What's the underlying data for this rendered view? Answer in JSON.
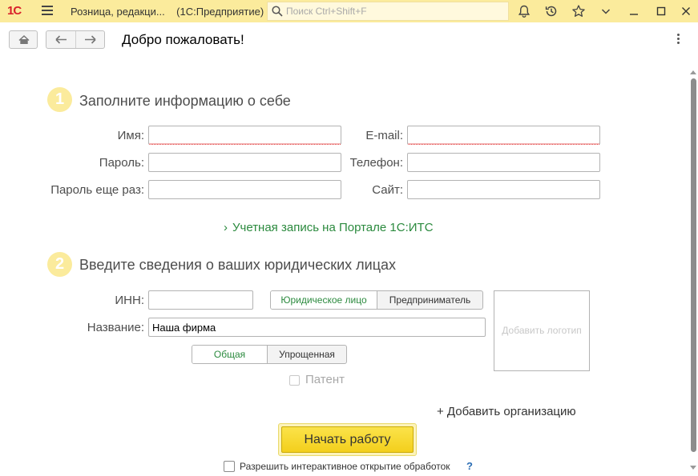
{
  "titlebar": {
    "logo": "1С",
    "app_title": "Розница, редакци...",
    "platform": "(1С:Предприятие)",
    "search_placeholder": "Поиск Ctrl+Shift+F",
    "icons": [
      "bell-icon",
      "history-icon",
      "star-icon",
      "chevron-down-icon",
      "minimize-icon",
      "maximize-icon",
      "close-icon"
    ]
  },
  "toolbar": {
    "page_title": "Добро пожаловать!",
    "icons": [
      "home-icon",
      "arrow-left-icon",
      "arrow-right-icon",
      "more-vertical-icon"
    ]
  },
  "section1": {
    "number": "1",
    "title": "Заполните информацию о себе",
    "fields": {
      "name": {
        "label": "Имя:",
        "value": ""
      },
      "password": {
        "label": "Пароль:",
        "value": ""
      },
      "password_repeat": {
        "label": "Пароль еще раз:",
        "value": ""
      },
      "email": {
        "label": "E-mail:",
        "value": ""
      },
      "phone": {
        "label": "Телефон:",
        "value": ""
      },
      "site": {
        "label": "Сайт:",
        "value": ""
      }
    },
    "its_link": "Учетная запись на Портале 1С:ИТС"
  },
  "section2": {
    "number": "2",
    "title": "Введите сведения о ваших юридических лицах",
    "inn": {
      "label": "ИНН:",
      "value": ""
    },
    "org_name": {
      "label": "Название:",
      "value": "Наша фирма"
    },
    "entity_type": {
      "options": [
        "Юридическое лицо",
        "Предприниматель"
      ],
      "selected": "Юридическое лицо"
    },
    "tax_system": {
      "options": [
        "Общая",
        "Упрощенная"
      ],
      "selected": "Общая"
    },
    "patent_label": "Патент",
    "add_logo": "Добавить логотип",
    "add_org": "+ Добавить организацию"
  },
  "footer": {
    "start_button": "Начать работу",
    "allow_label": "Разрешить интерактивное открытие обработок",
    "help": "?"
  },
  "colors": {
    "titlebar": "#fbeb9c",
    "accent_green": "#2b8a3e",
    "start_button": "#f3cf1c"
  }
}
